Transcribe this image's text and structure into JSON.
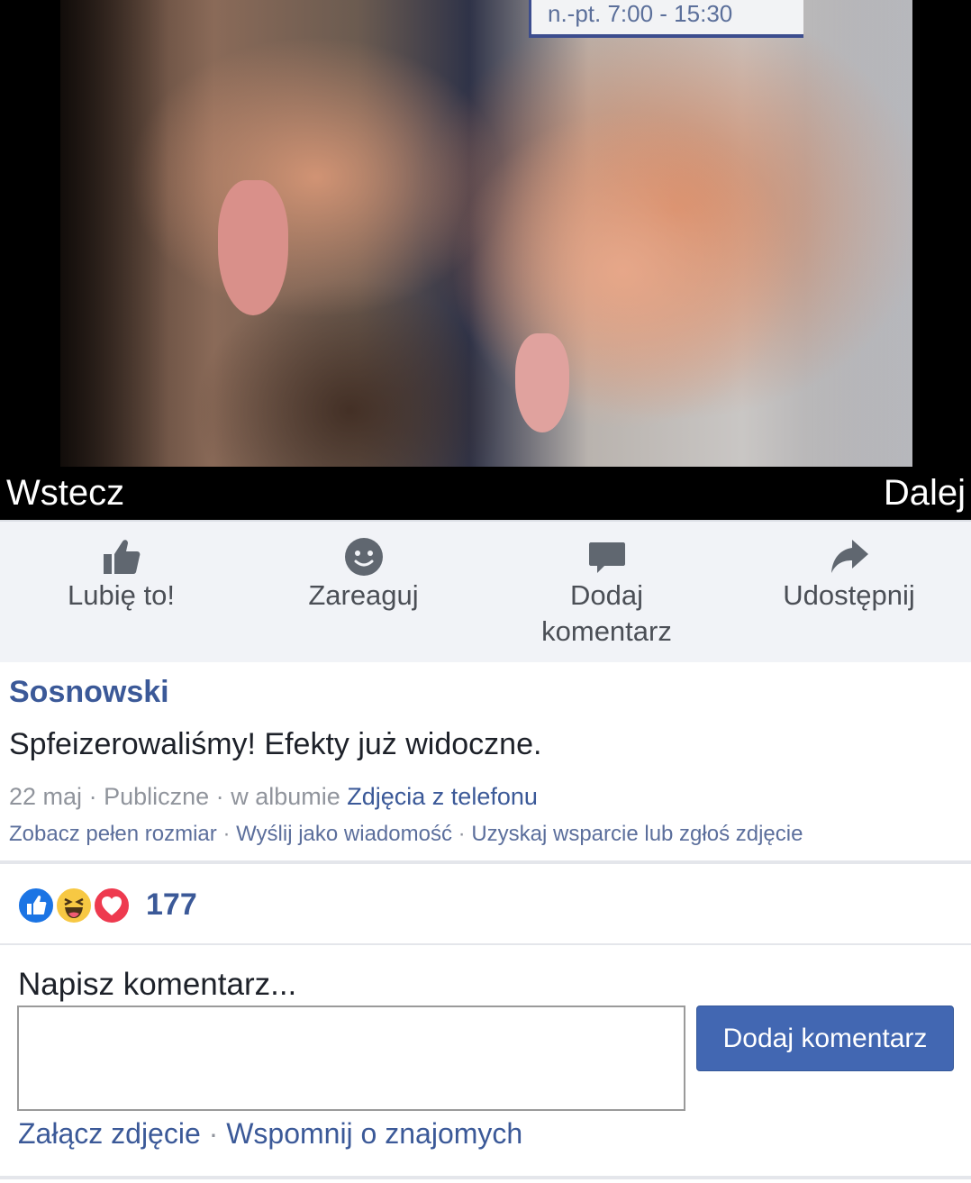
{
  "photo": {
    "sign_text": "n.-pt. 7:00 - 15:30"
  },
  "nav": {
    "prev_label": "Wstecz",
    "next_label": "Dalej"
  },
  "actions": [
    {
      "label": "Lubię to!",
      "icon": "thumbs-up-icon"
    },
    {
      "label": "Zareaguj",
      "icon": "smiley-icon"
    },
    {
      "label_line1": "Dodaj",
      "label_line2": "komentarz",
      "icon": "comment-icon"
    },
    {
      "label": "Udostępnij",
      "icon": "share-arrow-icon"
    }
  ],
  "post": {
    "author": "Sosnowski",
    "caption": "Spfeizerowaliśmy! Efekty już widoczne.",
    "date": "22 maj",
    "privacy": "Publiczne",
    "album_prefix": "w albumie",
    "album_name": "Zdjęcia z telefonu",
    "links": [
      "Zobacz pełen rozmiar",
      "Wyślij jako wiadomość",
      "Uzyskaj wsparcie lub zgłoś zdjęcie"
    ],
    "separator": "·"
  },
  "reactions": {
    "types": [
      "like",
      "haha",
      "love"
    ],
    "count": "177"
  },
  "comment": {
    "label": "Napisz komentarz...",
    "input_value": "",
    "submit_label": "Dodaj komentarz",
    "attach_photo": "Załącz zdjęcie",
    "mention_friends": "Wspomnij o znajomych"
  },
  "colors": {
    "brand_blue": "#3b5998",
    "button_blue": "#4267b2",
    "action_bar_bg": "#f1f3f7",
    "muted_text": "#90949c"
  }
}
